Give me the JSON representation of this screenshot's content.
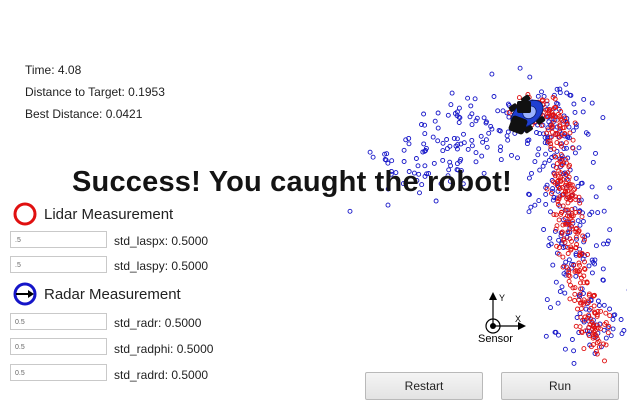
{
  "stats": {
    "time": "Time: 4.08",
    "distance": "Distance to Target: 0.1953",
    "best": "Best Distance: 0.0421"
  },
  "banner": "Success! You caught the robot!",
  "lidar": {
    "title": "Lidar Measurement",
    "color": "#e01010",
    "fields": [
      {
        "value": ".5",
        "label": "std_laspx: 0.5000"
      },
      {
        "value": ".5",
        "label": "std_laspy: 0.5000"
      }
    ]
  },
  "radar": {
    "title": "Radar Measurement",
    "color": "#1515c8",
    "fields": [
      {
        "value": "0.5",
        "label": "std_radr: 0.5000"
      },
      {
        "value": "0.5",
        "label": "std_radphi: 0.5000"
      },
      {
        "value": "0.5",
        "label": "std_radrd: 0.5000"
      }
    ]
  },
  "sensor": {
    "label": "Sensor",
    "x_axis": "X",
    "y_axis": "Y"
  },
  "buttons": {
    "restart": "Restart",
    "run": "Run"
  },
  "colors": {
    "lidar_points": "#e01010",
    "radar_points": "#1515c8",
    "car": "#1f3fd1"
  }
}
